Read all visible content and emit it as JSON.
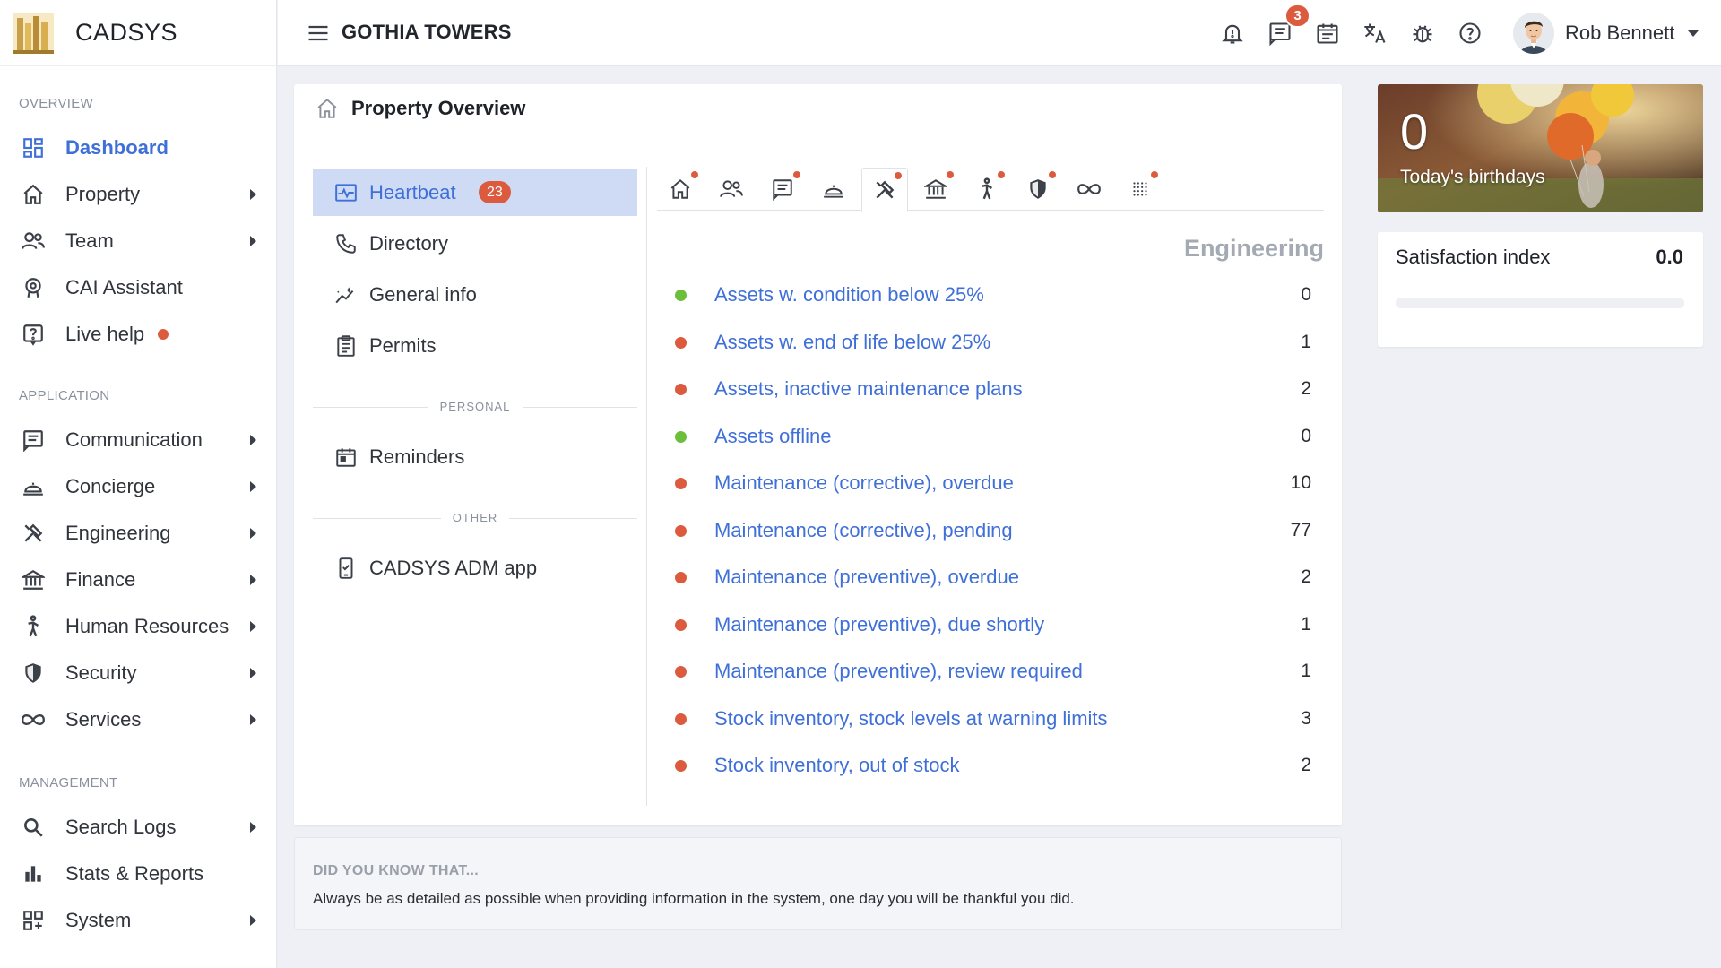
{
  "brand": {
    "name": "CADSYS"
  },
  "topbar": {
    "property": "GOTHIA TOWERS",
    "messages_badge": "3",
    "user_name": "Rob Bennett"
  },
  "sidebar": {
    "sections": [
      {
        "title": "OVERVIEW"
      },
      {
        "title": "APPLICATION"
      },
      {
        "title": "MANAGEMENT"
      }
    ],
    "items": [
      {
        "label": "Dashboard",
        "icon": "dashboard-icon"
      },
      {
        "label": "Property",
        "icon": "home-icon"
      },
      {
        "label": "Team",
        "icon": "team-icon"
      },
      {
        "label": "CAI Assistant",
        "icon": "assistant-icon"
      },
      {
        "label": "Live help",
        "icon": "help-icon"
      },
      {
        "label": "Communication",
        "icon": "message-icon"
      },
      {
        "label": "Concierge",
        "icon": "concierge-bell-icon"
      },
      {
        "label": "Engineering",
        "icon": "tools-icon"
      },
      {
        "label": "Finance",
        "icon": "bank-icon"
      },
      {
        "label": "Human Resources",
        "icon": "person-walking-icon"
      },
      {
        "label": "Security",
        "icon": "shield-icon"
      },
      {
        "label": "Services",
        "icon": "infinity-icon"
      },
      {
        "label": "Search Logs",
        "icon": "search-icon"
      },
      {
        "label": "Stats & Reports",
        "icon": "bar-chart-icon"
      },
      {
        "label": "System",
        "icon": "grid-icon"
      }
    ]
  },
  "main": {
    "title": "Property Overview",
    "sub_nav": {
      "items": [
        {
          "label": "Heartbeat",
          "badge": "23"
        },
        {
          "label": "Directory"
        },
        {
          "label": "General info"
        },
        {
          "label": "Permits"
        },
        {
          "label": "Reminders"
        },
        {
          "label": "CADSYS ADM app"
        }
      ],
      "separators": [
        "PERSONAL",
        "OTHER"
      ]
    },
    "section_heading": "Engineering",
    "heartbeat": [
      {
        "label": "Assets w. condition below 25%",
        "value": "0",
        "status": "ok"
      },
      {
        "label": "Assets w. end of life below 25%",
        "value": "1",
        "status": "alert"
      },
      {
        "label": "Assets, inactive maintenance plans",
        "value": "2",
        "status": "alert"
      },
      {
        "label": "Assets offline",
        "value": "0",
        "status": "ok"
      },
      {
        "label": "Maintenance (corrective), overdue",
        "value": "10",
        "status": "alert"
      },
      {
        "label": "Maintenance (corrective), pending",
        "value": "77",
        "status": "alert"
      },
      {
        "label": "Maintenance (preventive), overdue",
        "value": "2",
        "status": "alert"
      },
      {
        "label": "Maintenance (preventive), due shortly",
        "value": "1",
        "status": "alert"
      },
      {
        "label": "Maintenance (preventive), review required",
        "value": "1",
        "status": "alert"
      },
      {
        "label": "Stock inventory, stock levels at warning limits",
        "value": "3",
        "status": "alert"
      },
      {
        "label": "Stock inventory, out of stock",
        "value": "2",
        "status": "alert"
      }
    ]
  },
  "tip": {
    "title": "DID YOU KNOW THAT...",
    "text": "Always be as detailed as possible when providing information in the system, one day you will be thankful you did."
  },
  "birthdays": {
    "count": "0",
    "label": "Today's birthdays"
  },
  "satisfaction": {
    "label": "Satisfaction index",
    "value": "0.0",
    "fraction": 0
  },
  "colors": {
    "accent": "#3f6fd8",
    "ok": "#6cbf3a",
    "alert": "#dc5b3e",
    "active_bg": "#cfdbf5"
  }
}
